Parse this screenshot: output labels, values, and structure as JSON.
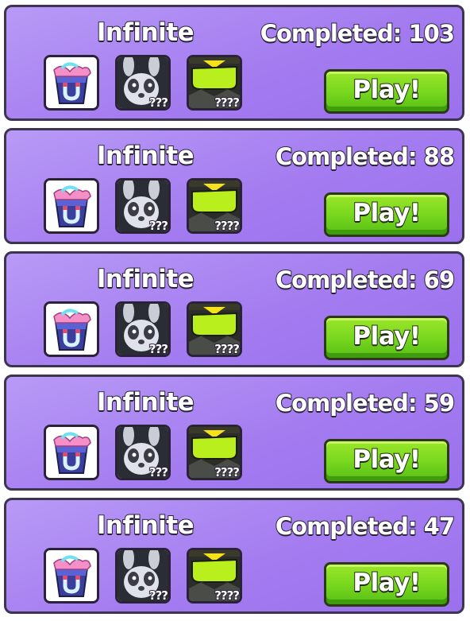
{
  "cards": [
    {
      "title": "Infinite",
      "completed": "Completed: 103",
      "play_label": "Play!",
      "slot2_locked": "???",
      "slot3_locked": "????"
    },
    {
      "title": "Infinite",
      "completed": "Completed: 88",
      "play_label": "Play!",
      "slot2_locked": "???",
      "slot3_locked": "????"
    },
    {
      "title": "Infinite",
      "completed": "Completed: 69",
      "play_label": "Play!",
      "slot2_locked": "???",
      "slot3_locked": "????"
    },
    {
      "title": "Infinite",
      "completed": "Completed: 59",
      "play_label": "Play!",
      "slot2_locked": "???",
      "slot3_locked": "????"
    },
    {
      "title": "Infinite",
      "completed": "Completed: 47",
      "play_label": "Play!",
      "slot2_locked": "???",
      "slot3_locked": "????"
    }
  ],
  "icons": {
    "slot1": "magnet-gift-box-icon",
    "slot2": "panda-pet-icon",
    "slot3": "slime-goggles-icon"
  },
  "colors": {
    "card_bg": "#a47cf0",
    "play_button": "#79d81e",
    "border": "#3d3550"
  }
}
